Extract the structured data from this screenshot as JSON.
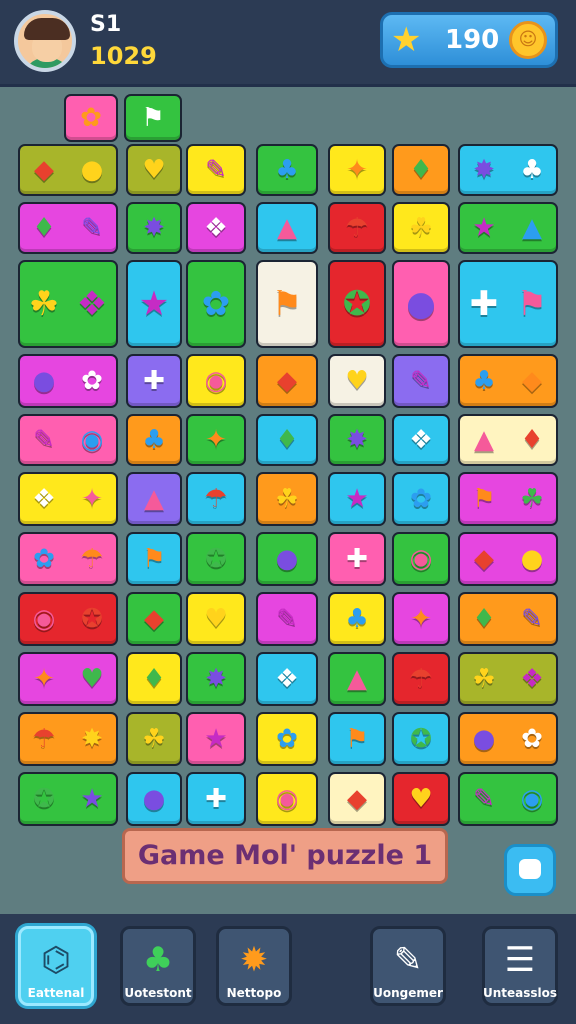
{
  "player": {
    "level_label": "S1",
    "score": "1029",
    "avatar_icon": "player-avatar"
  },
  "currency": {
    "amount": "190",
    "star_icon": "star-icon",
    "coin_icon": "coin-icon"
  },
  "board": {
    "title": "Game Mol' puzzle 1",
    "palette": {
      "green": "#34c340",
      "yellow": "#ffe81c",
      "magenta": "#e646e0",
      "cyan": "#2fc6ee",
      "orange": "#ff9a1c",
      "red": "#e5262d",
      "olive": "#a8b52a",
      "purple": "#8b6cf0",
      "white": "#f6f2e4",
      "pink": "#ff5fb0",
      "cream": "#fff4c0"
    }
  },
  "bottom_nav": {
    "items": [
      {
        "label": "Eattenal",
        "icon": "bandage-icon"
      },
      {
        "label": "Uotestont",
        "icon": "leaf-icon"
      },
      {
        "label": "Nettopo",
        "icon": "gear-icon"
      },
      {
        "label": "Uongemer",
        "icon": "pencil-icon"
      },
      {
        "label": "Unteasslos",
        "icon": "menu-icon"
      }
    ]
  }
}
